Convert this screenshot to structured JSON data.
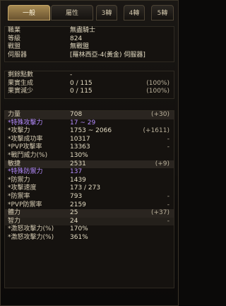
{
  "tabs": [
    "一般",
    "屬性",
    "3轉",
    "4轉",
    "5轉"
  ],
  "info": [
    {
      "k": "職業",
      "v": "無盡騎士",
      "x": ""
    },
    {
      "k": "等級",
      "v": "824",
      "x": ""
    },
    {
      "k": "戰盟",
      "v": "無戰盟",
      "x": ""
    },
    {
      "k": "伺服器",
      "v": "[羅林西亞-4(黃金) 伺服器]",
      "x": ""
    }
  ],
  "points": [
    {
      "k": "剩餘點數",
      "v": "-",
      "x": ""
    },
    {
      "k": "果實生成",
      "v": "0 / 115",
      "x": "(100%)"
    },
    {
      "k": "果實減少",
      "v": "0 / 115",
      "x": "(100%)"
    }
  ],
  "stats": [
    {
      "k": "力量",
      "v": "708",
      "x": "(+30)",
      "style": "hl"
    },
    {
      "k": "*特殊攻擊力",
      "v": "17 ~ 29",
      "x": "",
      "style": "special"
    },
    {
      "k": "*攻擊力",
      "v": "1753 ~ 2066",
      "x": "(+1611)",
      "style": ""
    },
    {
      "k": "*攻擊成功率",
      "v": "10317",
      "x": "-",
      "style": ""
    },
    {
      "k": "*PVP攻擊率",
      "v": "13363",
      "x": "-",
      "style": ""
    },
    {
      "k": "*戰鬥威力(%)",
      "v": "130%",
      "x": "",
      "style": ""
    },
    {
      "k": "敏捷",
      "v": "2531",
      "x": "(+9)",
      "style": "hl"
    },
    {
      "k": "*特殊防禦力",
      "v": "137",
      "x": "",
      "style": "special"
    },
    {
      "k": "*防禦力",
      "v": "1439",
      "x": "",
      "style": ""
    },
    {
      "k": "*攻擊速度",
      "v": "173 / 273",
      "x": "",
      "style": ""
    },
    {
      "k": "*防禦率",
      "v": "793",
      "x": "-",
      "style": ""
    },
    {
      "k": "*PVP防禦率",
      "v": "2159",
      "x": "-",
      "style": ""
    },
    {
      "k": "體力",
      "v": "25",
      "x": "(+37)",
      "style": "hl"
    },
    {
      "k": "智力",
      "v": "24",
      "x": "-",
      "style": "hl2"
    },
    {
      "k": "*激怒攻擊力(%)",
      "v": "170%",
      "x": "",
      "style": ""
    },
    {
      "k": "*激怒攻擊力(%)",
      "v": "361%",
      "x": "",
      "style": ""
    }
  ]
}
